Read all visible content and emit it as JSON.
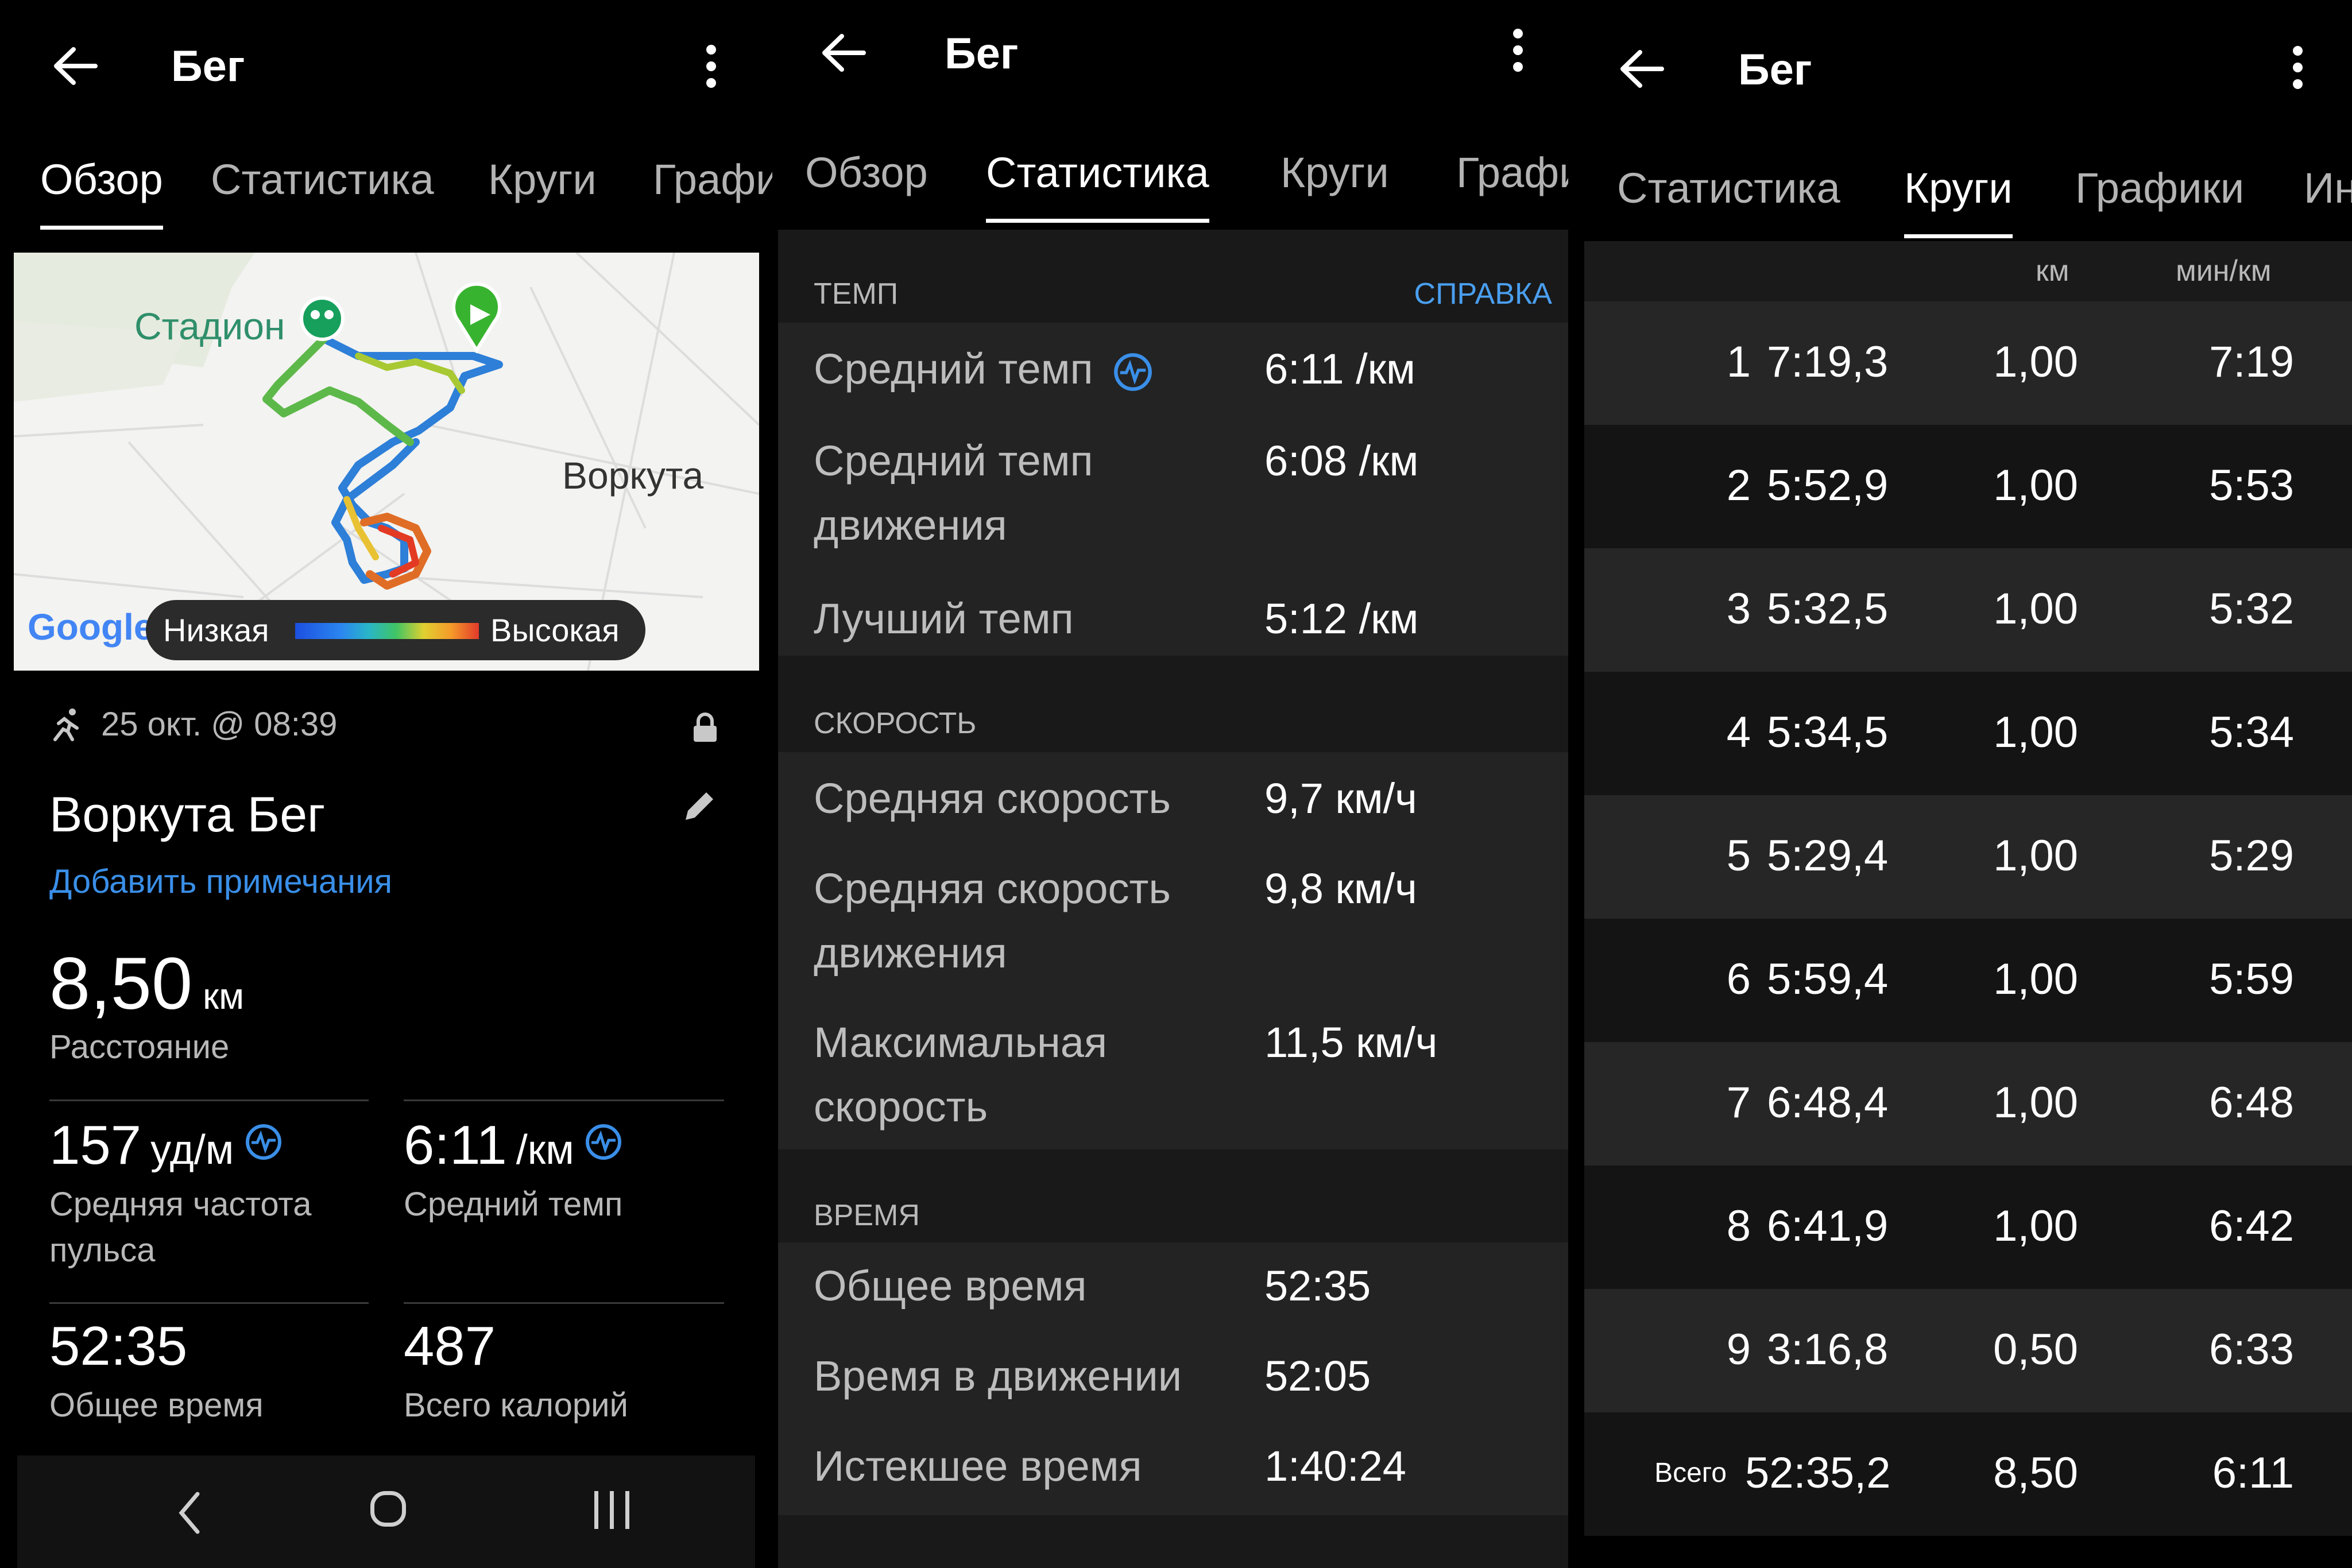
{
  "panel_overview": {
    "title": "Бег",
    "tabs": [
      "Обзор",
      "Статистика",
      "Круги",
      "Графи"
    ],
    "active_tab": 0,
    "map": {
      "label_stadium": "Стадион",
      "label_city": "Воркута",
      "google": "Google",
      "legend_low": "Низкая",
      "legend_high": "Высокая"
    },
    "date": "25 окт. @ 08:39",
    "activity_name": "Воркута Бег",
    "add_note": "Добавить примечания",
    "distance": {
      "value": "8,50",
      "unit": "км",
      "label": "Расстояние"
    },
    "stats": [
      {
        "value": "157",
        "unit": "уд/м",
        "label": "Средняя частота пульса"
      },
      {
        "value": "6:11",
        "unit": "/км",
        "label": "Средний темп"
      },
      {
        "value": "52:35",
        "unit": "",
        "label": "Общее время"
      },
      {
        "value": "487",
        "unit": "",
        "label": "Всего калорий"
      }
    ]
  },
  "panel_stats": {
    "title": "Бег",
    "tabs": [
      "Обзор",
      "Статистика",
      "Круги",
      "Графи"
    ],
    "active_tab": 1,
    "sections": [
      {
        "header": "ТЕМП",
        "help": "СПРАВКА",
        "rows": [
          {
            "label": "Средний темп",
            "value": "6:11 /км",
            "icon": "heart-rate-icon"
          },
          {
            "label": "Средний темп движения",
            "value": "6:08 /км"
          },
          {
            "label": "Лучший темп",
            "value": "5:12 /км"
          }
        ]
      },
      {
        "header": "СКОРОСТЬ",
        "rows": [
          {
            "label": "Средняя скорость",
            "value": "9,7 км/ч"
          },
          {
            "label": "Средняя скорость движения",
            "value": "9,8 км/ч"
          },
          {
            "label": "Максимальная скорость",
            "value": "11,5 км/ч"
          }
        ]
      },
      {
        "header": "ВРЕМЯ",
        "rows": [
          {
            "label": "Общее время",
            "value": "52:35"
          },
          {
            "label": "Время в движении",
            "value": "52:05"
          },
          {
            "label": "Истекшее время",
            "value": "1:40:24"
          }
        ]
      }
    ]
  },
  "panel_laps": {
    "title": "Бег",
    "tabs": [
      "Статистика",
      "Круги",
      "Графики",
      "Ин"
    ],
    "active_tab": 1,
    "columns": {
      "dist": "км",
      "pace": "мин/км"
    },
    "laps": [
      {
        "num": "1",
        "time": "7:19,3",
        "dist": "1,00",
        "pace": "7:19"
      },
      {
        "num": "2",
        "time": "5:52,9",
        "dist": "1,00",
        "pace": "5:53"
      },
      {
        "num": "3",
        "time": "5:32,5",
        "dist": "1,00",
        "pace": "5:32"
      },
      {
        "num": "4",
        "time": "5:34,5",
        "dist": "1,00",
        "pace": "5:34"
      },
      {
        "num": "5",
        "time": "5:29,4",
        "dist": "1,00",
        "pace": "5:29"
      },
      {
        "num": "6",
        "time": "5:59,4",
        "dist": "1,00",
        "pace": "5:59"
      },
      {
        "num": "7",
        "time": "6:48,4",
        "dist": "1,00",
        "pace": "6:48"
      },
      {
        "num": "8",
        "time": "6:41,9",
        "dist": "1,00",
        "pace": "6:42"
      },
      {
        "num": "9",
        "time": "3:16,8",
        "dist": "0,50",
        "pace": "6:33"
      }
    ],
    "total": {
      "num": "Всего",
      "time": "52:35,2",
      "dist": "8,50",
      "pace": "6:11"
    }
  },
  "colors": {
    "accent_blue": "#3a8fe8",
    "map_bg": "#f3f3f1",
    "row_dark": "#141414",
    "row_light": "#262626"
  }
}
